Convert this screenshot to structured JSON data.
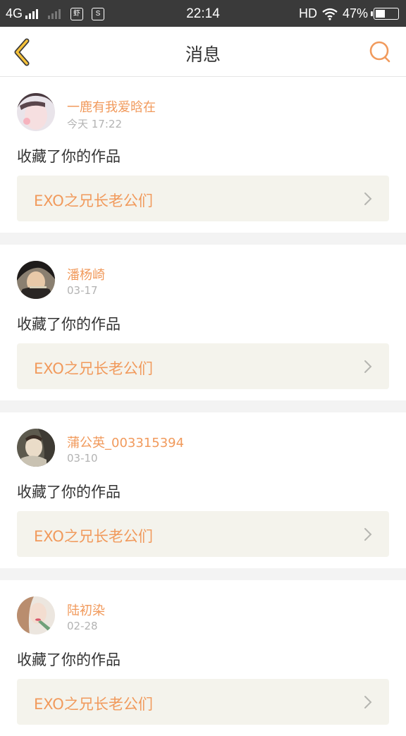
{
  "status_bar": {
    "network": "4G",
    "app_icon_1": "虾",
    "app_icon_2": "S",
    "time": "22:14",
    "hd": "HD",
    "battery_percent": "47%",
    "battery_level": 0.47
  },
  "nav": {
    "title": "消息",
    "back_icon": "chevron-left-icon",
    "search_icon": "search-icon",
    "accent": "#f19a5c"
  },
  "messages": [
    {
      "username": "一鹿有我爱晗在",
      "time": "今天 17:22",
      "action": "收藏了你的作品",
      "work_title": "EXO之兄长老公们"
    },
    {
      "username": "潘杨崎",
      "time": "03-17",
      "action": "收藏了你的作品",
      "work_title": "EXO之兄长老公们"
    },
    {
      "username": "蒲公英_003315394",
      "time": "03-10",
      "action": "收藏了你的作品",
      "work_title": "EXO之兄长老公们"
    },
    {
      "username": "陆初染",
      "time": "02-28",
      "action": "收藏了你的作品",
      "work_title": "EXO之兄长老公们"
    }
  ]
}
